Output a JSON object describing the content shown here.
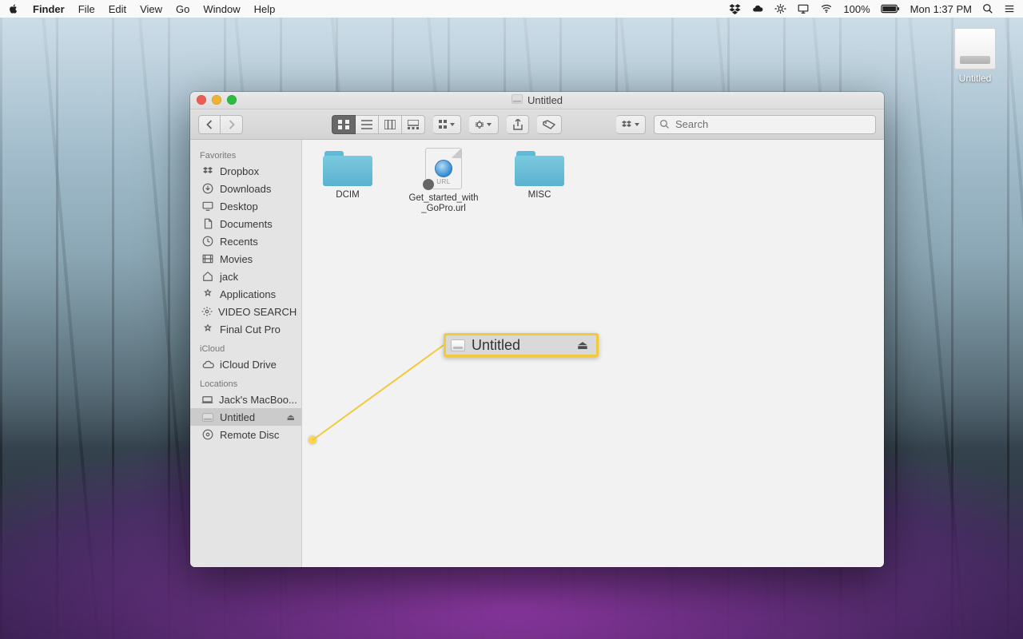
{
  "menubar": {
    "app": "Finder",
    "items": [
      "File",
      "Edit",
      "View",
      "Go",
      "Window",
      "Help"
    ],
    "battery": "100%",
    "clock": "Mon 1:37 PM"
  },
  "desktop": {
    "drive_label": "Untitled"
  },
  "window": {
    "title": "Untitled",
    "search_placeholder": "Search"
  },
  "sidebar": {
    "favorites_header": "Favorites",
    "icloud_header": "iCloud",
    "locations_header": "Locations",
    "favorites": [
      {
        "label": "Dropbox"
      },
      {
        "label": "Downloads"
      },
      {
        "label": "Desktop"
      },
      {
        "label": "Documents"
      },
      {
        "label": "Recents"
      },
      {
        "label": "Movies"
      },
      {
        "label": "jack"
      },
      {
        "label": "Applications"
      },
      {
        "label": "VIDEO SEARCH"
      },
      {
        "label": "Final Cut Pro"
      }
    ],
    "icloud": [
      {
        "label": "iCloud Drive"
      }
    ],
    "locations": [
      {
        "label": "Jack's MacBoo..."
      },
      {
        "label": "Untitled"
      },
      {
        "label": "Remote Disc"
      }
    ]
  },
  "files": {
    "items": [
      {
        "name": "DCIM",
        "type": "folder"
      },
      {
        "name": "Get_started_with_GoPro.url",
        "type": "url"
      },
      {
        "name": "MISC",
        "type": "folder"
      }
    ]
  },
  "callout": {
    "label": "Untitled"
  }
}
